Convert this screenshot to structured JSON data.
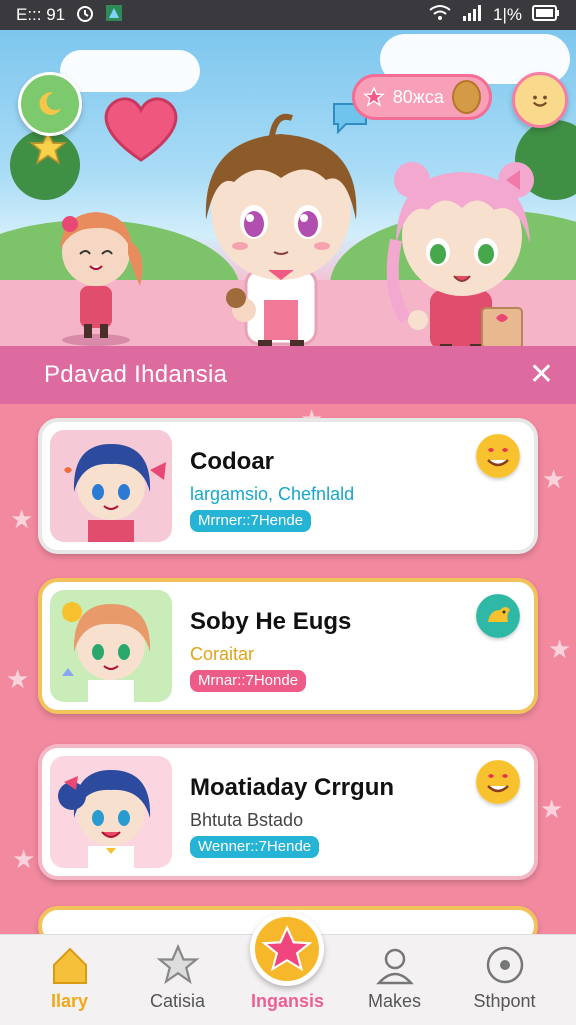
{
  "status_bar": {
    "left_text": "E::: 91",
    "battery_text": "1|%"
  },
  "hero": {
    "coin_text": "80жса",
    "icons": {
      "left": "moon-icon",
      "right": "smiley-face-icon",
      "pill": "star-icon"
    }
  },
  "panel": {
    "title": "Pdavad Ihdansia",
    "close_label": "✕"
  },
  "cards": [
    {
      "name": "Codoar",
      "subtitle": "largamsio, Chefnlald",
      "subtitle_color": "#19a6c9",
      "tag": "Mrrner::7Hende",
      "tag_color": "#25b3d6",
      "emoji": "heart-eyes-emoji"
    },
    {
      "name": "Soby He Eugs",
      "subtitle": "Coraitar",
      "subtitle_color": "#e0a21a",
      "tag": "Mrnar::7Honde",
      "tag_color": "#ee5b87",
      "emoji": "duck-emoji"
    },
    {
      "name": "Moatiaday Crrgun",
      "subtitle": "Bhtuta Bstado",
      "subtitle_color": "#444444",
      "tag": "Wenner::7Hende",
      "tag_color": "#25b3d6",
      "emoji": "heart-eyes-emoji"
    }
  ],
  "nav": [
    {
      "label": "Ilary",
      "icon": "home-icon",
      "active_color": "#f0a81a"
    },
    {
      "label": "Catisia",
      "icon": "star-outline-icon"
    },
    {
      "label": "Ingansis",
      "icon": "star-icon",
      "active_color": "#ef5f95"
    },
    {
      "label": "Makes",
      "icon": "user-icon"
    },
    {
      "label": "Sthpont",
      "icon": "support-icon"
    }
  ]
}
